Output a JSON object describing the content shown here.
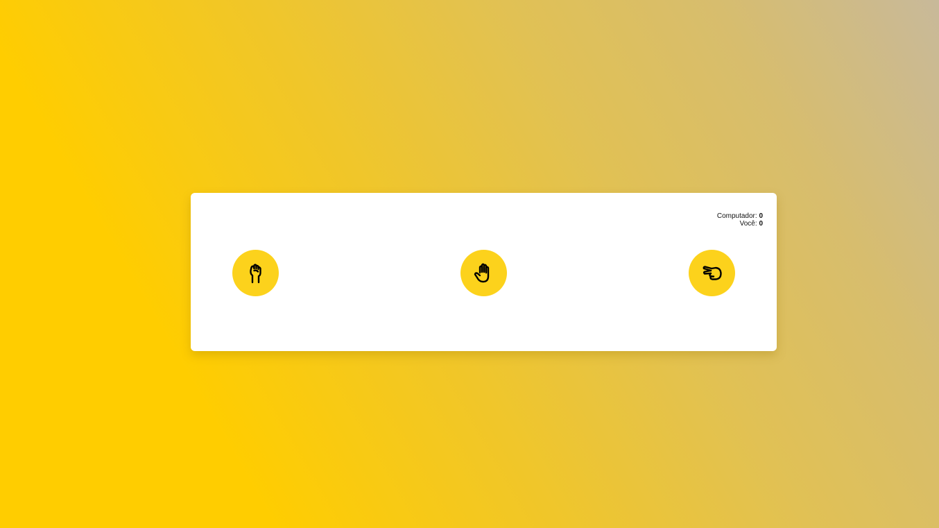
{
  "scoreboard": {
    "computer_label": "Computador: ",
    "computer_score": "0",
    "player_label": "Você: ",
    "player_score": "0"
  },
  "choices": [
    {
      "id": "rock",
      "icon": "fist-hand-icon"
    },
    {
      "id": "paper",
      "icon": "open-hand-icon"
    },
    {
      "id": "scissors",
      "icon": "scissors-hand-icon"
    }
  ],
  "colors": {
    "background_start": "#ffcd00",
    "background_end": "#c8b99a",
    "card": "#ffffff",
    "button": "#fcd21c",
    "icon_stroke": "#000000"
  }
}
